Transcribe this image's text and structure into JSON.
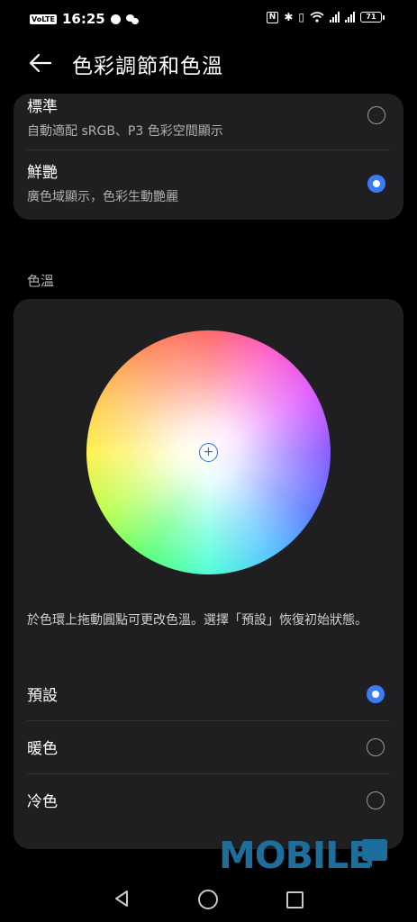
{
  "status_bar": {
    "volte": "VoLTE",
    "time": "16:25",
    "nfc": "N",
    "battery": "71"
  },
  "header": {
    "title": "色彩調節和色溫"
  },
  "color_mode": {
    "options": [
      {
        "title": "標準",
        "subtitle": "自動適配 sRGB、P3 色彩空間顯示",
        "selected": false
      },
      {
        "title": "鮮艷",
        "subtitle": "廣色域顯示，色彩生動艷麗",
        "selected": true
      }
    ]
  },
  "color_temp": {
    "section_label": "色溫",
    "description": "於色環上拖動圓點可更改色溫。選擇「預設」恢復初始狀態。",
    "presets": [
      {
        "label": "預設",
        "selected": true
      },
      {
        "label": "暖色",
        "selected": false
      },
      {
        "label": "冷色",
        "selected": false
      }
    ]
  },
  "watermark": {
    "text": "MOBILE"
  },
  "colors": {
    "accent": "#3b7cf5",
    "card_bg": "#1f1f21",
    "background": "#000000"
  }
}
